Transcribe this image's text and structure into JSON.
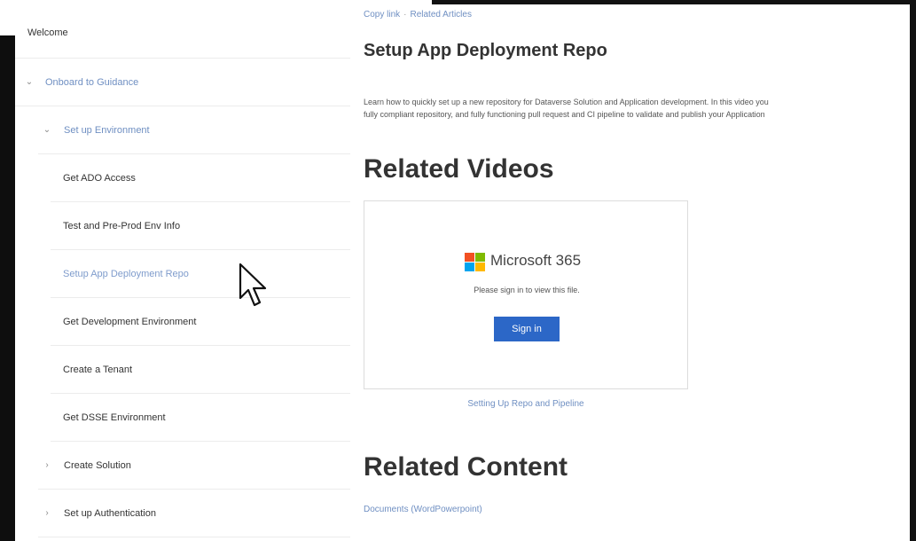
{
  "sidebar": {
    "welcome": "Welcome",
    "items": [
      {
        "label": "Onboard to Guidance",
        "level": 0,
        "chevron": "⌄",
        "style": "link"
      },
      {
        "label": "Set up Environment",
        "level": 1,
        "chevron": "⌄",
        "style": "link"
      },
      {
        "label": "Get ADO Access",
        "level": 2,
        "chevron": "",
        "style": "normal"
      },
      {
        "label": "Test and Pre-Prod Env Info",
        "level": 2,
        "chevron": "",
        "style": "normal"
      },
      {
        "label": "Setup App Deployment Repo",
        "level": 2,
        "chevron": "",
        "style": "active"
      },
      {
        "label": "Get Development Environment",
        "level": 2,
        "chevron": "",
        "style": "normal"
      },
      {
        "label": "Create a Tenant",
        "level": 2,
        "chevron": "",
        "style": "normal"
      },
      {
        "label": "Get DSSE Environment",
        "level": 2,
        "chevron": "",
        "style": "normal"
      },
      {
        "label": "Create Solution",
        "level": 1,
        "chevron": "›",
        "style": "normal"
      },
      {
        "label": "Set up Authentication",
        "level": 1,
        "chevron": "›",
        "style": "normal"
      }
    ]
  },
  "main": {
    "breadcrumb": [
      "Copy link",
      "Related Articles"
    ],
    "title": "Setup App Deployment Repo",
    "description": [
      "Learn how to quickly set up a new repository for Dataverse Solution and Application development. In this video you",
      "fully compliant repository, and fully functioning pull request and CI pipeline to validate and publish your Application"
    ],
    "related_videos_heading": "Related Videos",
    "video": {
      "brand": "Microsoft 365",
      "prompt": "Please sign in to view this file.",
      "signin_label": "Sign in",
      "caption": "Setting Up Repo and Pipeline"
    },
    "related_content_heading": "Related Content",
    "related_content_link": "Documents (WordPowerpoint)"
  },
  "colors": {
    "link": "#6f8fc2",
    "button": "#2c67c7"
  },
  "icons": {
    "microsoft_logo": "microsoft-logo-icon",
    "cursor": "mouse-pointer-icon"
  }
}
